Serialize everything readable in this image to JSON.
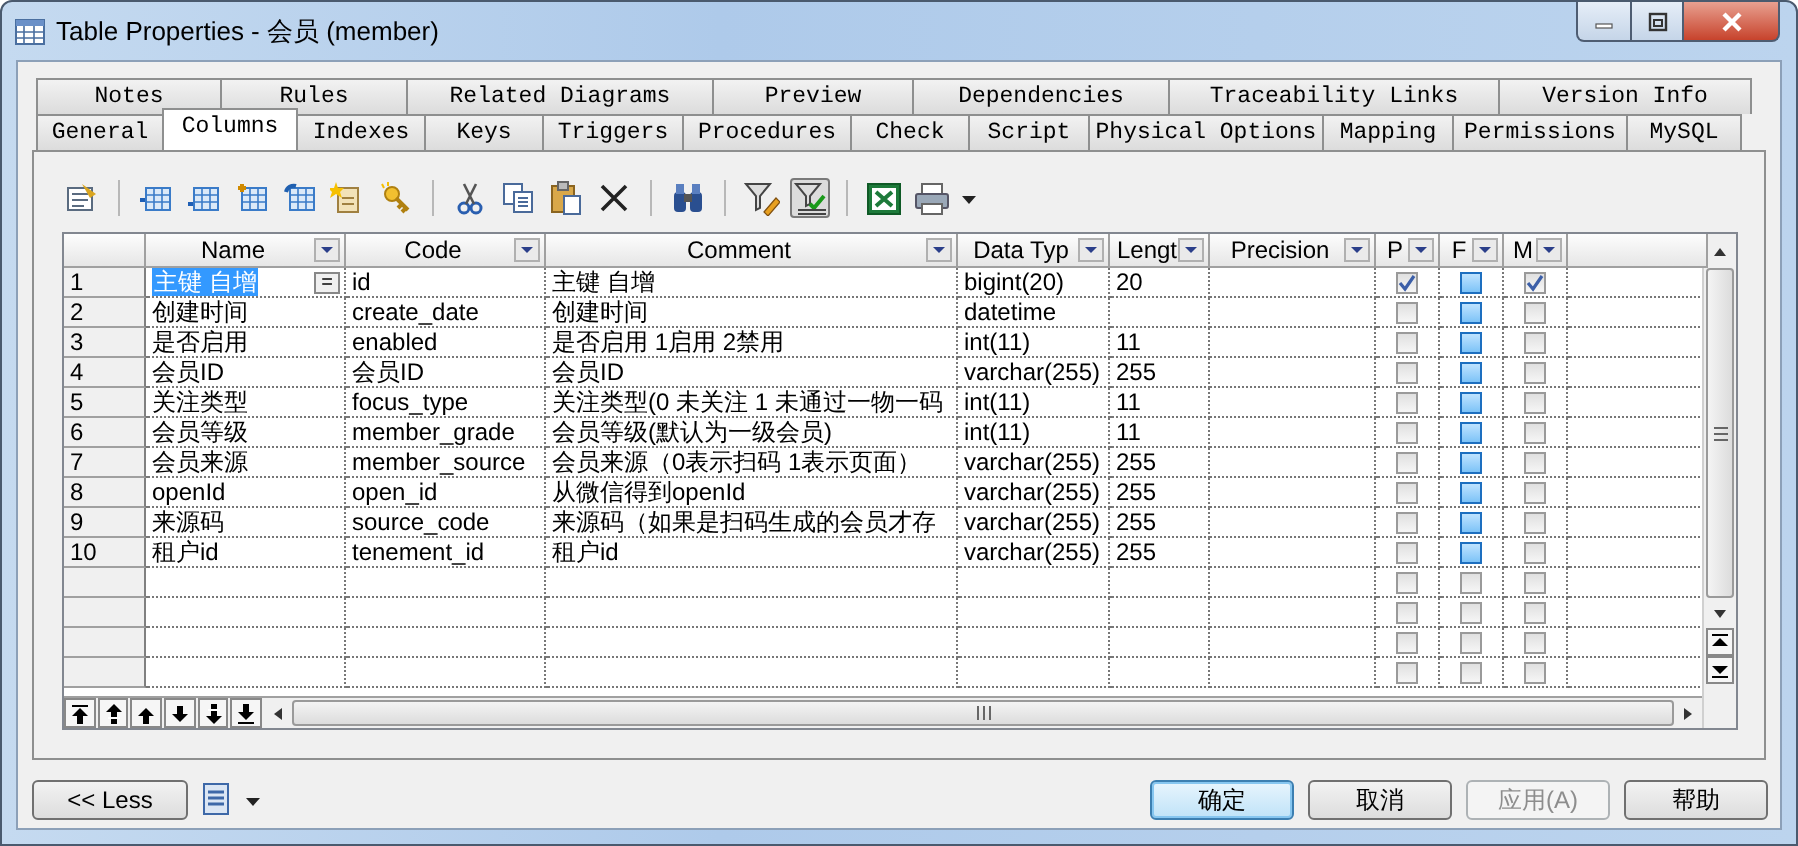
{
  "window": {
    "title": "Table Properties - 会员 (member)"
  },
  "tabs_back": [
    {
      "label": "Notes",
      "selected": false
    },
    {
      "label": "Rules",
      "selected": false
    },
    {
      "label": "Related Diagrams",
      "selected": false
    },
    {
      "label": "Preview",
      "selected": false
    },
    {
      "label": "Dependencies",
      "selected": false
    },
    {
      "label": "Traceability Links",
      "selected": false
    },
    {
      "label": "Version Info",
      "selected": false
    }
  ],
  "tabs_front": [
    {
      "label": "General",
      "selected": false
    },
    {
      "label": "Columns",
      "selected": true
    },
    {
      "label": "Indexes",
      "selected": false
    },
    {
      "label": "Keys",
      "selected": false
    },
    {
      "label": "Triggers",
      "selected": false
    },
    {
      "label": "Procedures",
      "selected": false
    },
    {
      "label": "Check",
      "selected": false
    },
    {
      "label": "Script",
      "selected": false
    },
    {
      "label": "Physical Options",
      "selected": false
    },
    {
      "label": "Mapping",
      "selected": false
    },
    {
      "label": "Permissions",
      "selected": false
    },
    {
      "label": "MySQL",
      "selected": false
    }
  ],
  "toolbar": {
    "filter_active": true
  },
  "grid": {
    "columns": [
      "Name",
      "Code",
      "Comment",
      "Data Typ",
      "Lengt",
      "Precision",
      "P",
      "F",
      "M"
    ],
    "cell_button": "=",
    "rows": [
      {
        "number": "1",
        "selected": true,
        "name": "主键 自增",
        "code": "id",
        "comment": "主键 自增",
        "data_type": "bigint(20)",
        "length": "20",
        "p": true,
        "f": false,
        "m": true
      },
      {
        "number": "2",
        "selected": false,
        "name": "创建时间",
        "code": "create_date",
        "comment": "创建时间",
        "data_type": "datetime",
        "p": false,
        "f": false,
        "m": false
      },
      {
        "number": "3",
        "selected": false,
        "name": "是否启用",
        "code": "enabled",
        "comment": "是否启用 1启用 2禁用",
        "data_type": "int(11)",
        "length": "11",
        "p": false,
        "f": false,
        "m": false
      },
      {
        "number": "4",
        "selected": false,
        "name": "会员ID",
        "code": "会员ID",
        "comment": "会员ID",
        "data_type": "varchar(255)",
        "length": "255",
        "p": false,
        "f": false,
        "m": false
      },
      {
        "number": "5",
        "selected": false,
        "name": "关注类型",
        "code": "focus_type",
        "comment": "关注类型(0 未关注 1 未通过一物一码",
        "data_type": "int(11)",
        "length": "11",
        "p": false,
        "f": false,
        "m": false
      },
      {
        "number": "6",
        "selected": false,
        "name": "会员等级",
        "code": "member_grade",
        "comment": "会员等级(默认为一级会员)",
        "data_type": "int(11)",
        "length": "11",
        "p": false,
        "f": false,
        "m": false
      },
      {
        "number": "7",
        "selected": false,
        "name": "会员来源",
        "code": "member_source",
        "comment": "会员来源（0表示扫码 1表示页面）",
        "data_type": "varchar(255)",
        "length": "255",
        "p": false,
        "f": false,
        "m": false
      },
      {
        "number": "8",
        "selected": false,
        "name": "openId",
        "code": "open_id",
        "comment": "从微信得到openId",
        "data_type": "varchar(255)",
        "length": "255",
        "p": false,
        "f": false,
        "m": false
      },
      {
        "number": "9",
        "selected": false,
        "name": "来源码",
        "code": "source_code",
        "comment": "来源码（如果是扫码生成的会员才存",
        "data_type": "varchar(255)",
        "length": "255",
        "p": false,
        "f": false,
        "m": false
      },
      {
        "number": "10",
        "selected": false,
        "name": "租户id",
        "code": "tenement_id",
        "comment": "租户id",
        "data_type": "varchar(255)",
        "length": "255",
        "p": false,
        "f": false,
        "m": false
      }
    ],
    "blank_rows": [
      {
        "p": false,
        "f": false,
        "m": false
      },
      {
        "p": false,
        "f": false,
        "m": false
      },
      {
        "p": false,
        "f": false,
        "m": false
      },
      {
        "p": false,
        "f": false,
        "m": false
      }
    ]
  },
  "less_button": "<< Less",
  "buttons": [
    {
      "label": "确定",
      "default": true,
      "disabled": false
    },
    {
      "label": "取消",
      "default": false,
      "disabled": false
    },
    {
      "label": "应用(A)",
      "default": false,
      "disabled": true
    },
    {
      "label": "帮助",
      "default": false,
      "disabled": false
    }
  ]
}
